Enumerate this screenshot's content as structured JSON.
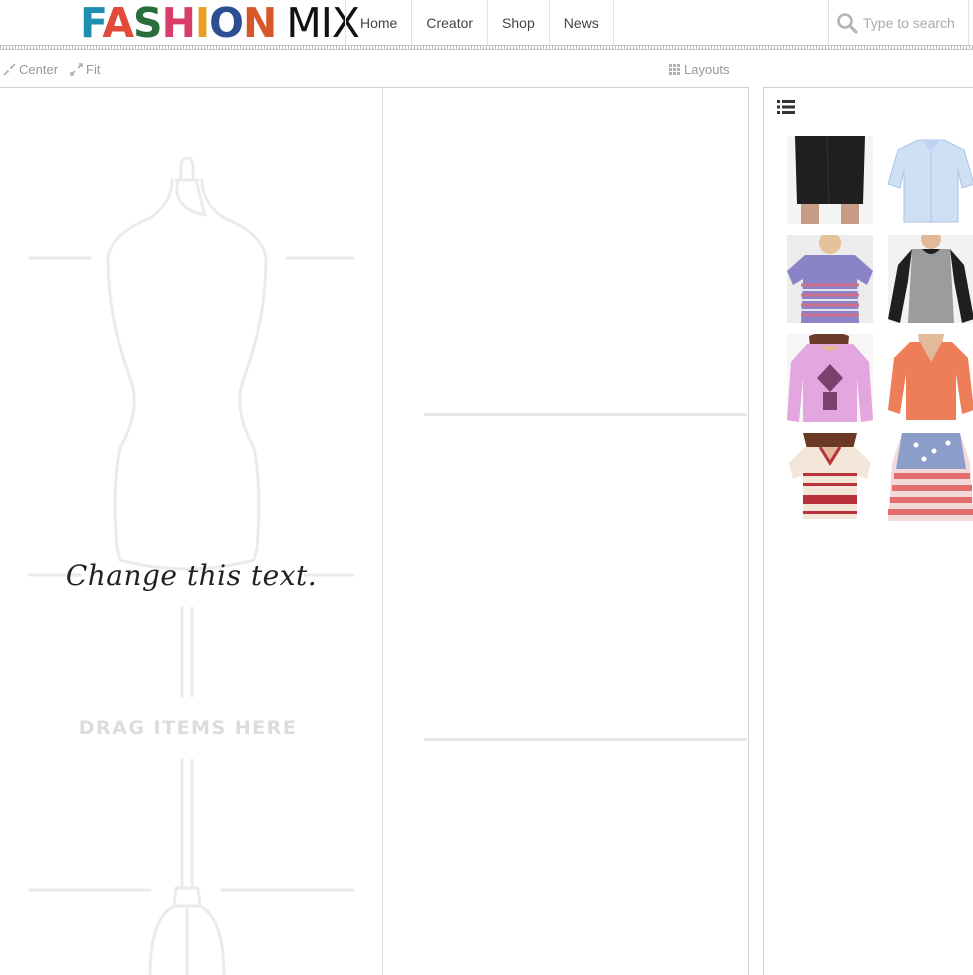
{
  "header": {
    "logo": {
      "word1": "FASHION",
      "word2": "MIX"
    },
    "nav": [
      "Home",
      "Creator",
      "Shop",
      "News"
    ],
    "search": {
      "placeholder": "Type to search"
    }
  },
  "toolbar": {
    "center_label": "Center",
    "fit_label": "Fit",
    "layouts_label": "Layouts"
  },
  "canvas": {
    "caption": "Change this text.",
    "drop_hint": "DRAG ITEMS HERE"
  },
  "items": [
    {
      "name": "black leather mini skirt",
      "colors": [
        "#1e1e1e",
        "#c9a48a"
      ]
    },
    {
      "name": "light blue striped button-up shirt",
      "colors": [
        "#cfe0f5",
        "#a9c4e8"
      ]
    },
    {
      "name": "purple tribal print tee",
      "colors": [
        "#8a84c7",
        "#cf6f8e"
      ]
    },
    {
      "name": "grey raglan tee with black sleeves",
      "colors": [
        "#9c9c9c",
        "#1f1f1f"
      ]
    },
    {
      "name": "lavender graphic long sleeve tee",
      "colors": [
        "#e3a6de",
        "#7e3f6e"
      ]
    },
    {
      "name": "coral v-neck long sleeve tee",
      "colors": [
        "#ee7e57",
        "#d66a45"
      ]
    },
    {
      "name": "red and cream striped henley tee",
      "colors": [
        "#b8313b",
        "#f3e6d8"
      ]
    },
    {
      "name": "stars and stripes flag top",
      "colors": [
        "#e46c6c",
        "#8a9ec9"
      ]
    }
  ]
}
